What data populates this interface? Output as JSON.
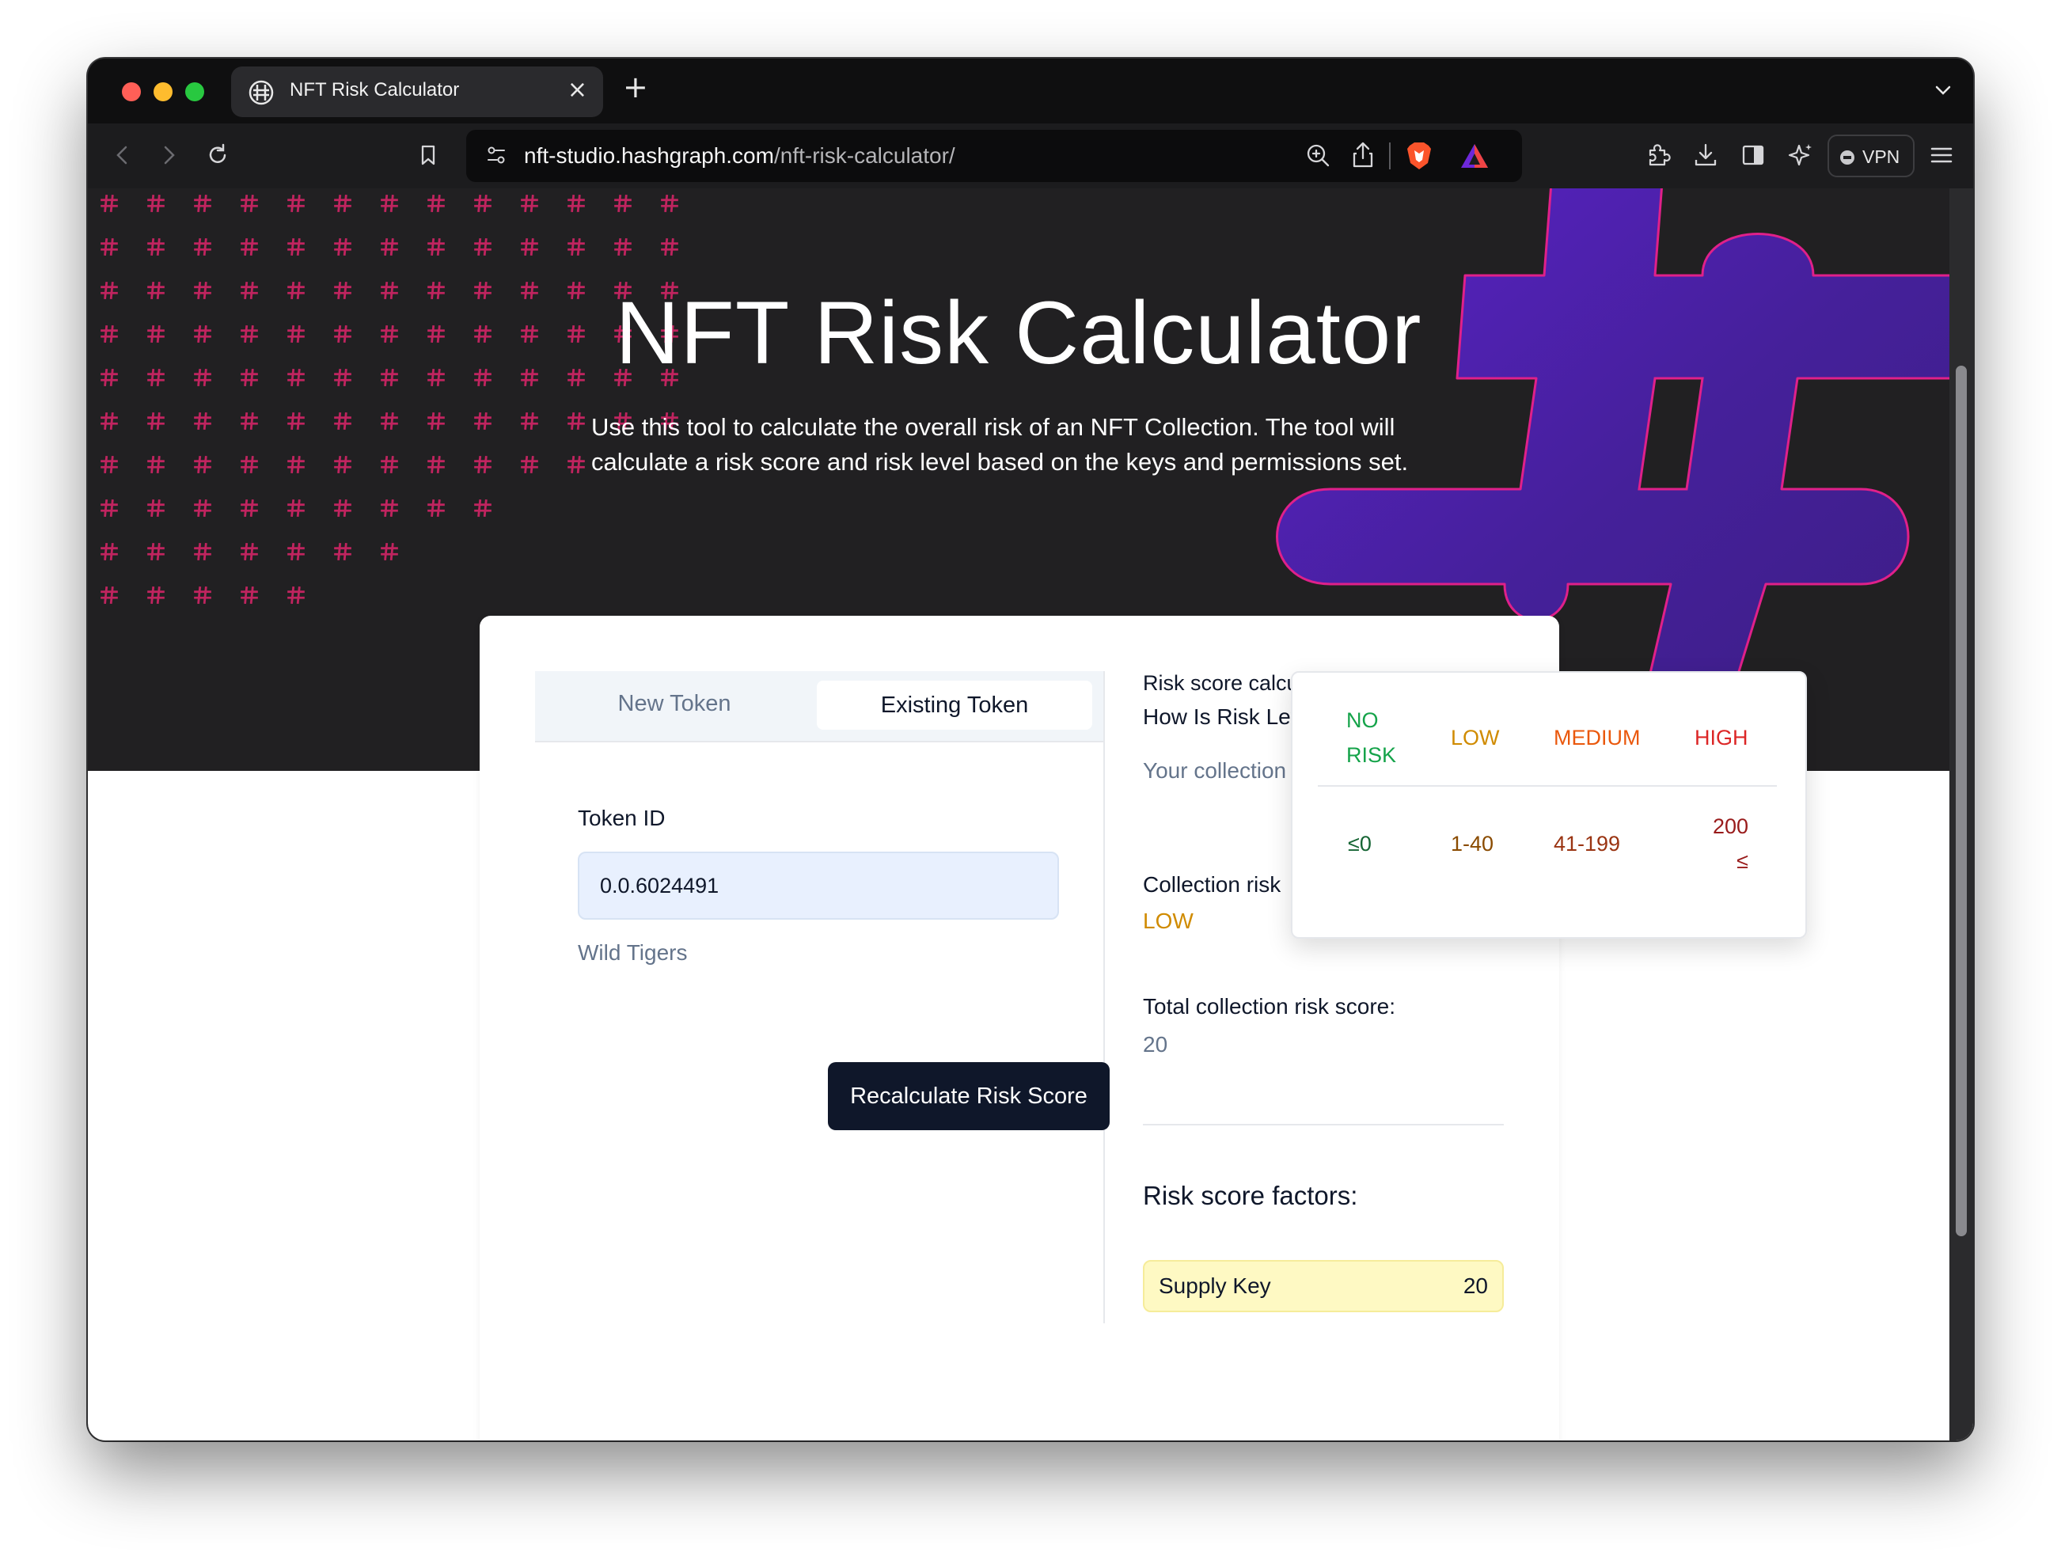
{
  "browser": {
    "tab_title": "NFT Risk Calculator",
    "tab_close": "×",
    "new_tab": "+",
    "url_host": "nft-studio.hashgraph.com",
    "url_path": "/nft-risk-calculator/",
    "vpn_label": "VPN"
  },
  "hero": {
    "title": "NFT Risk Calculator",
    "subtitle": "Use this tool to calculate the overall risk of an NFT Collection. The tool will calculate a risk score and risk level based on the keys and permissions set."
  },
  "form": {
    "tabs": [
      {
        "label": "New Token",
        "active": false
      },
      {
        "label": "Existing Token",
        "active": true
      }
    ],
    "token_id_label": "Token ID",
    "token_id_value": "0.0.6024491",
    "token_name": "Wild Tigers",
    "recalculate_label": "Recalculate Risk Score"
  },
  "result": {
    "heading": "Risk score calculation",
    "how_link": "How Is Risk Level Calculated?",
    "description": "Your collection calculated.",
    "level_label": "Collection risk",
    "level_value": "LOW",
    "total_label": "Total collection risk score:",
    "total_value": "20",
    "factors_title": "Risk score factors:",
    "factors": [
      {
        "name": "Supply Key",
        "score": "20"
      }
    ]
  },
  "popover": {
    "headers": [
      {
        "lines": [
          "NO",
          "RISK"
        ],
        "color": "#15a34a"
      },
      {
        "lines": [
          "LOW"
        ],
        "color": "#d08b00"
      },
      {
        "lines": [
          "MEDIUM"
        ],
        "color": "#ea580c"
      },
      {
        "lines": [
          "HIGH"
        ],
        "color": "#dc2626"
      }
    ],
    "values": [
      {
        "lines": [
          "≤0"
        ],
        "color": "#166534"
      },
      {
        "lines": [
          "1-40"
        ],
        "color": "#8a4b00"
      },
      {
        "lines": [
          "41-199"
        ],
        "color": "#9a3412"
      },
      {
        "lines": [
          "200",
          "≤"
        ],
        "color": "#991b1b"
      }
    ]
  },
  "colors": {
    "hero_bg": "#212022",
    "pattern_hash": "#c0245f",
    "big_hash_fill": "#4b1fa8",
    "big_hash_stroke": "#e0208a",
    "primary_button": "#0f172a"
  }
}
